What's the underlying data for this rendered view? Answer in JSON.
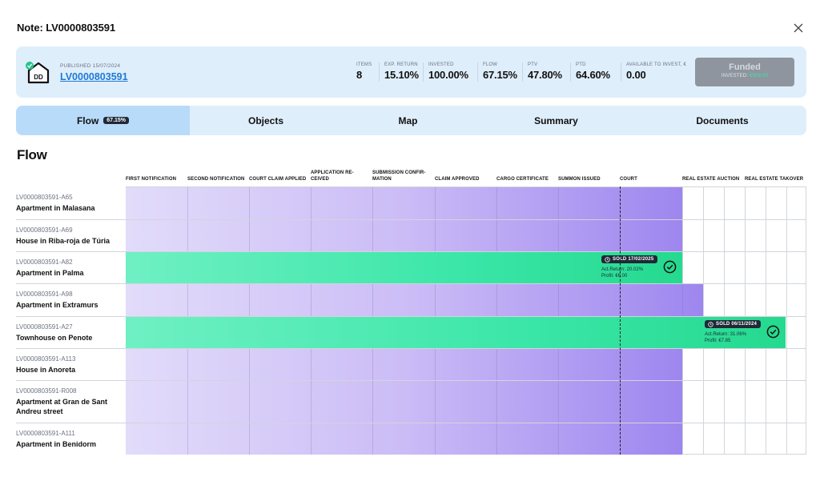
{
  "window": {
    "title": "Note: LV0000803591"
  },
  "summary": {
    "published": "PUBLISHED 15/07/2024",
    "note_id": "LV0000803591",
    "stats": [
      {
        "label": "ITEMS",
        "value": "8"
      },
      {
        "label": "EXP. RETURN",
        "value": "15.10%"
      },
      {
        "label": "INVESTED",
        "value": "100.00%"
      },
      {
        "label": "FLOW",
        "value": "67.15%"
      },
      {
        "label": "PTV",
        "value": "47.80%"
      },
      {
        "label": "PTD",
        "value": "64.60%"
      },
      {
        "label": "AVAILABLE TO INVEST, €",
        "value": "0.00"
      }
    ],
    "funded_button": {
      "label": "Funded",
      "invested_label": "INVESTED:",
      "invested_amount": "€508.00"
    }
  },
  "tabs": [
    {
      "label": "Flow",
      "badge": "67.15%",
      "active": true
    },
    {
      "label": "Objects"
    },
    {
      "label": "Map"
    },
    {
      "label": "Summary"
    },
    {
      "label": "Documents"
    }
  ],
  "flow": {
    "title": "Flow",
    "stages": [
      "FIRST NOTIFICATION",
      "SECOND NOTIFICATION",
      "COURT CLAIM APPLIED",
      "APPLICATION RE-CEIVED",
      "SUBMISSION CONFIR-MATION",
      "CLAIM APPROVED",
      "CARGO CERTIFICATE",
      "SUMMON ISSUED",
      "COURT",
      "REAL ESTATE AUCTION",
      "REAL ESTATE TAKOVER"
    ],
    "rows": [
      {
        "id": "LV0000803591-A65",
        "name": "Apartment in Malasana",
        "progress": 0.818,
        "status": "in-progress"
      },
      {
        "id": "LV0000803591-A69",
        "name": "House in Riba-roja de Túria",
        "progress": 0.818,
        "status": "in-progress"
      },
      {
        "id": "LV0000803591-A82",
        "name": "Apartment in Palma",
        "progress": 0.818,
        "status": "sold",
        "sold": "SOLD 17/02/2025",
        "act_return": "Act.Return: 20.02%",
        "profit": "Profit: €6.00"
      },
      {
        "id": "LV0000803591-A98",
        "name": "Apartment in Extramurs",
        "progress": 0.848,
        "status": "in-progress"
      },
      {
        "id": "LV0000803591-A27",
        "name": "Townhouse on Penote",
        "progress": 0.969,
        "status": "sold",
        "sold": "SOLD 06/11/2024",
        "act_return": "Act.Return: 31.06%",
        "profit": "Profit: €7.85"
      },
      {
        "id": "LV0000803591-A113",
        "name": "House in Anoreta",
        "progress": 0.818,
        "status": "in-progress"
      },
      {
        "id": "LV0000803591-R008",
        "name": "Apartment at Gran de Sant Andreu street",
        "progress": 0.818,
        "status": "in-progress"
      },
      {
        "id": "LV0000803591-A111",
        "name": "Apartment in Benidorm",
        "progress": 0.818,
        "status": "in-progress"
      }
    ]
  },
  "colors": {
    "accent": "#1e7ad6",
    "flow_purple": "#9e86ef",
    "sold_green": "#25d98f",
    "tab_active": "#b8dbfa",
    "card_bg": "#dfeefb"
  },
  "icons": {
    "close": "close-icon",
    "house": "house-dd-icon",
    "sold_clock": "clock-icon",
    "sold_check": "check-circle-icon"
  }
}
